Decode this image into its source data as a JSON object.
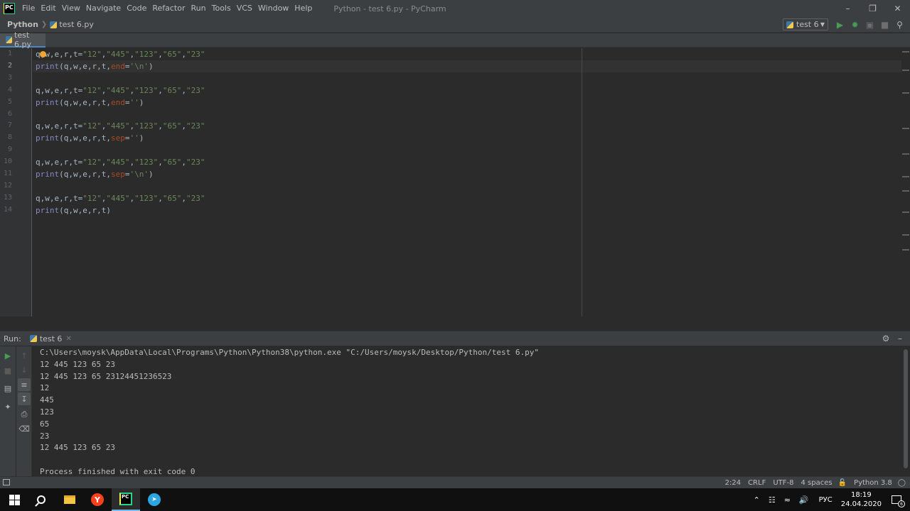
{
  "titlebar": {
    "window_title": "Python - test 6.py - PyCharm",
    "menu": [
      "File",
      "Edit",
      "View",
      "Navigate",
      "Code",
      "Refactor",
      "Run",
      "Tools",
      "VCS",
      "Window",
      "Help"
    ]
  },
  "navbar": {
    "project": "Python",
    "file": "test 6.py",
    "run_config": "test 6"
  },
  "editor": {
    "tab_label": "test 6.py",
    "line_numbers": [
      "1",
      "2",
      "3",
      "4",
      "5",
      "6",
      "7",
      "8",
      "9",
      "10",
      "11",
      "12",
      "13",
      "14"
    ],
    "current_line": 2,
    "lines": [
      [
        [
          "plain",
          "q,w,e,r,t="
        ],
        [
          "str",
          "\"12\""
        ],
        [
          "plain",
          ","
        ],
        [
          "str",
          "\"445\""
        ],
        [
          "plain",
          ","
        ],
        [
          "str",
          "\"123\""
        ],
        [
          "plain",
          ","
        ],
        [
          "str",
          "\"65\""
        ],
        [
          "plain",
          ","
        ],
        [
          "str",
          "\"23\""
        ]
      ],
      [
        [
          "builtin",
          "print"
        ],
        [
          "plain",
          "(q,w,e,r,t,"
        ],
        [
          "kw",
          "end"
        ],
        [
          "plain",
          "="
        ],
        [
          "str",
          "'\\n'"
        ],
        [
          "plain",
          ")"
        ]
      ],
      [],
      [
        [
          "plain",
          "q,w,e,r,t="
        ],
        [
          "str",
          "\"12\""
        ],
        [
          "plain",
          ","
        ],
        [
          "str",
          "\"445\""
        ],
        [
          "plain",
          ","
        ],
        [
          "str",
          "\"123\""
        ],
        [
          "plain",
          ","
        ],
        [
          "str",
          "\"65\""
        ],
        [
          "plain",
          ","
        ],
        [
          "str",
          "\"23\""
        ]
      ],
      [
        [
          "builtin",
          "print"
        ],
        [
          "plain",
          "(q,w,e,r,t,"
        ],
        [
          "kw",
          "end"
        ],
        [
          "plain",
          "="
        ],
        [
          "str",
          "''"
        ],
        [
          "plain",
          ")"
        ]
      ],
      [],
      [
        [
          "plain",
          "q,w,e,r,t="
        ],
        [
          "str",
          "\"12\""
        ],
        [
          "plain",
          ","
        ],
        [
          "str",
          "\"445\""
        ],
        [
          "plain",
          ","
        ],
        [
          "str",
          "\"123\""
        ],
        [
          "plain",
          ","
        ],
        [
          "str",
          "\"65\""
        ],
        [
          "plain",
          ","
        ],
        [
          "str",
          "\"23\""
        ]
      ],
      [
        [
          "builtin",
          "print"
        ],
        [
          "plain",
          "(q,w,e,r,t,"
        ],
        [
          "kw",
          "sep"
        ],
        [
          "plain",
          "="
        ],
        [
          "str",
          "''"
        ],
        [
          "plain",
          ")"
        ]
      ],
      [],
      [
        [
          "plain",
          "q,w,e,r,t="
        ],
        [
          "str",
          "\"12\""
        ],
        [
          "plain",
          ","
        ],
        [
          "str",
          "\"445\""
        ],
        [
          "plain",
          ","
        ],
        [
          "str",
          "\"123\""
        ],
        [
          "plain",
          ","
        ],
        [
          "str",
          "\"65\""
        ],
        [
          "plain",
          ","
        ],
        [
          "str",
          "\"23\""
        ]
      ],
      [
        [
          "builtin",
          "print"
        ],
        [
          "plain",
          "(q,w,e,r,t,"
        ],
        [
          "kw",
          "sep"
        ],
        [
          "plain",
          "="
        ],
        [
          "str",
          "'\\n'"
        ],
        [
          "plain",
          ")"
        ]
      ],
      [],
      [
        [
          "plain",
          "q,w,e,r,t="
        ],
        [
          "str",
          "\"12\""
        ],
        [
          "plain",
          ","
        ],
        [
          "str",
          "\"445\""
        ],
        [
          "plain",
          ","
        ],
        [
          "str",
          "\"123\""
        ],
        [
          "plain",
          ","
        ],
        [
          "str",
          "\"65\""
        ],
        [
          "plain",
          ","
        ],
        [
          "str",
          "\"23\""
        ]
      ],
      [
        [
          "builtin",
          "print"
        ],
        [
          "plain",
          "(q,w,e,r,t)"
        ]
      ]
    ]
  },
  "run": {
    "label": "Run:",
    "tab": "test 6",
    "output": [
      "C:\\Users\\moysk\\AppData\\Local\\Programs\\Python\\Python38\\python.exe \"C:/Users/moysk/Desktop/Python/test 6.py\"",
      "12 445 123 65 23",
      "12 445 123 65 23124451236523",
      "12",
      "445",
      "123",
      "65",
      "23",
      "12 445 123 65 23",
      "",
      "Process finished with exit code 0"
    ]
  },
  "statusbar": {
    "position": "2:24",
    "line_sep": "CRLF",
    "encoding": "UTF-8",
    "indent": "4 spaces",
    "interpreter": "Python 3.8"
  },
  "taskbar": {
    "language": "РУС",
    "time": "18:19",
    "date": "24.04.2020",
    "notification_count": "6"
  },
  "colors": {
    "background": "#2b2b2b",
    "panel": "#3c3f41",
    "string": "#6a8759",
    "builtin": "#8888c6",
    "keyword_arg": "#aa4926",
    "run_green": "#499c54"
  }
}
